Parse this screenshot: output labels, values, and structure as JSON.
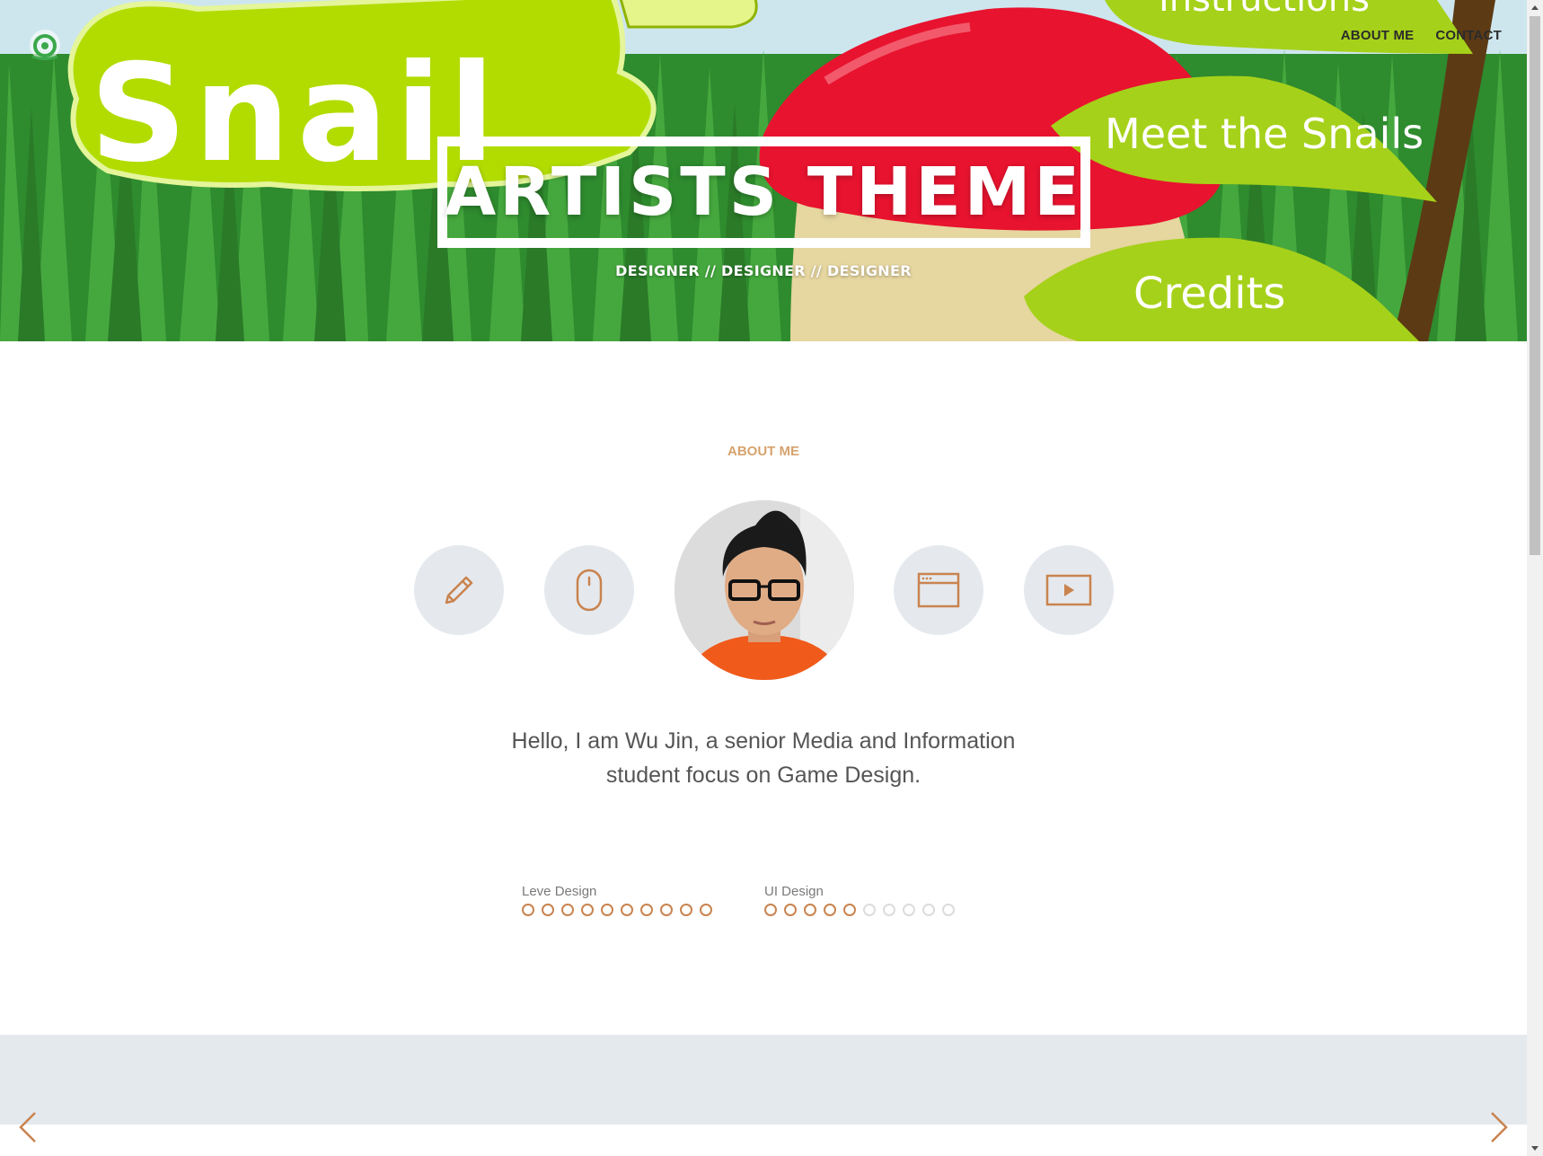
{
  "hero": {
    "title": "ARTISTS THEME",
    "subtitle": "DESIGNER // DESIGNER // DESIGNER",
    "art_text": {
      "snail": "Snail",
      "sign_top": "Instructions",
      "sign_middle": "Meet the Snails",
      "sign_bottom": "Credits"
    }
  },
  "nav": {
    "items": [
      {
        "label": "ABOUT ME"
      },
      {
        "label": "CONTACT"
      }
    ]
  },
  "about": {
    "heading": "ABOUT ME",
    "icons": [
      "pencil-icon",
      "mouse-icon",
      "browser-window-icon",
      "play-icon"
    ],
    "bio": "Hello, I am Wu Jin, a senior Media and Information student focus on Game Design.",
    "skills": [
      {
        "label": "Leve Design",
        "level": 10,
        "max": 10
      },
      {
        "label": "UI Design",
        "level": 5,
        "max": 10
      }
    ]
  },
  "colors": {
    "accent": "#d6a36d",
    "dot_active": "#c9834f",
    "icon_circle": "#e5e9ee",
    "band": "#e4e9ee"
  }
}
